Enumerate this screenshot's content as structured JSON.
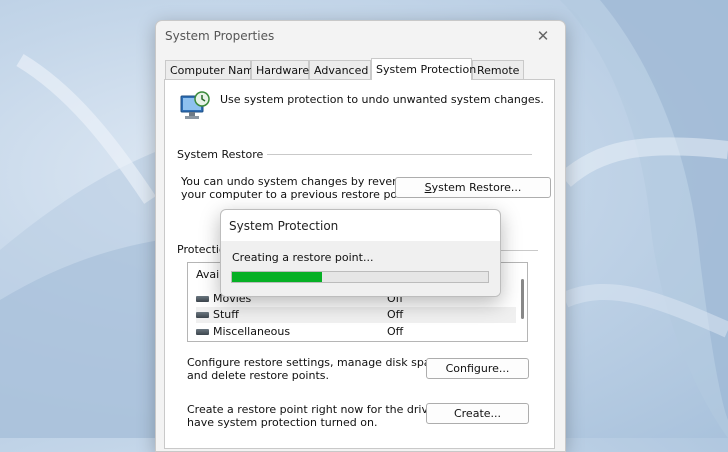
{
  "window": {
    "title": "System Properties",
    "tabs": [
      {
        "label": "Computer Name",
        "active": false
      },
      {
        "label": "Hardware",
        "active": false
      },
      {
        "label": "Advanced",
        "active": false
      },
      {
        "label": "System Protection",
        "active": true
      },
      {
        "label": "Remote",
        "active": false
      }
    ]
  },
  "protection_tab": {
    "intro": "Use system protection to undo unwanted system changes.",
    "system_restore": {
      "group_label": "System Restore",
      "description_line1": "You can undo system changes by reverting",
      "description_line2": "your computer to a previous restore point.",
      "button_label": "System Restore...",
      "button_mnemonic": "S"
    },
    "protection_settings": {
      "group_label_partial": "Protection",
      "list_header_partial": "Avail",
      "drives": [
        {
          "name": "Movies",
          "status": "Off"
        },
        {
          "name": "Stuff",
          "status": "Off"
        },
        {
          "name": "Miscellaneous",
          "status": "Off"
        }
      ]
    },
    "configure": {
      "text_line1": "Configure restore settings, manage disk space,",
      "text_line2": "and delete restore points.",
      "button_label": "Configure..."
    },
    "create": {
      "text_line1": "Create a restore point right now for the drives that",
      "text_line2": "have system protection turned on.",
      "button_label": "Create..."
    }
  },
  "progress_dialog": {
    "title": "System Protection",
    "message": "Creating a restore point...",
    "progress_fraction": 0.35
  },
  "colors": {
    "progress_fill": "#06b025",
    "window_bg": "#f3f3f3"
  }
}
